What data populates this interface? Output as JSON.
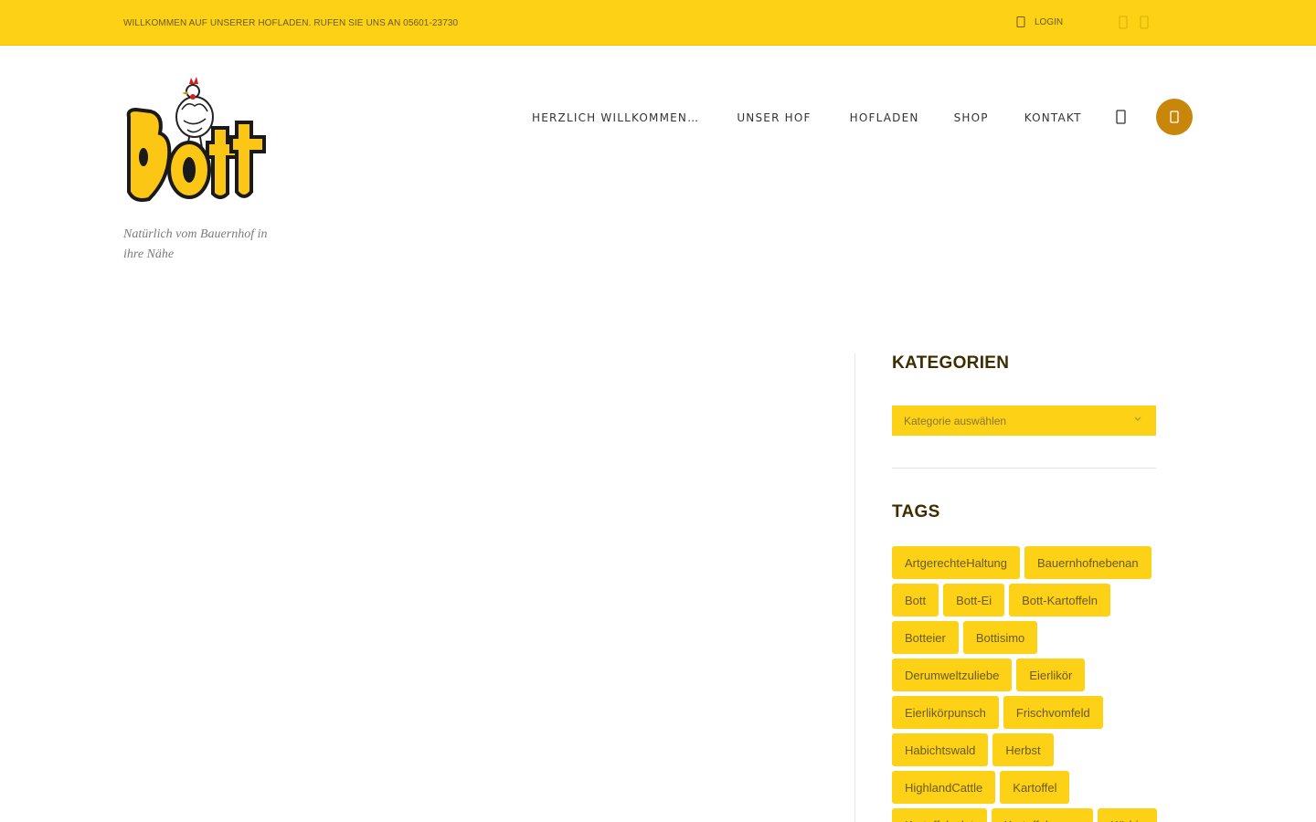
{
  "topbar": {
    "welcome_text": "WILLKOMMEN AUF UNSERER HOFLADEN. RUFEN SIE UNS AN 05601-23730",
    "login_label": "LOGIN",
    "user_icon": "user-icon",
    "social_icons": [
      "social-icon",
      "social-icon"
    ]
  },
  "header": {
    "logo_text": "Bott",
    "tagline": "Natürlich vom Bauernhof in ihre Nähe",
    "nav": [
      "HERZLICH WILLKOMMEN…",
      "UNSER HOF",
      "HOFLADEN",
      "SHOP",
      "KONTAKT"
    ],
    "search_icon": "search-icon",
    "cart_icon": "cart-icon"
  },
  "sidebar": {
    "categories_title": "KATEGORIEN",
    "category_select_placeholder": "Kategorie auswählen",
    "tags_title": "TAGS",
    "tags": [
      "ArtgerechteHaltung",
      "Bauernhofnebenan",
      "Bott",
      "Bott-Ei",
      "Bott-Kartoffeln",
      "Botteier",
      "Bottisimo",
      "Derumweltzuliebe",
      "Eierlikör",
      "Eierlikörpunsch",
      "Frischvomfeld",
      "Habichtswald",
      "Herbst",
      "HighlandCattle",
      "Kartoffel",
      "Kartoffelsalat",
      "Kartoffelsuppe",
      "Kürbis"
    ]
  },
  "colors": {
    "brand_yellow": "#fcd116",
    "accent_brown": "#c8870a",
    "heading": "#3d2d00"
  }
}
